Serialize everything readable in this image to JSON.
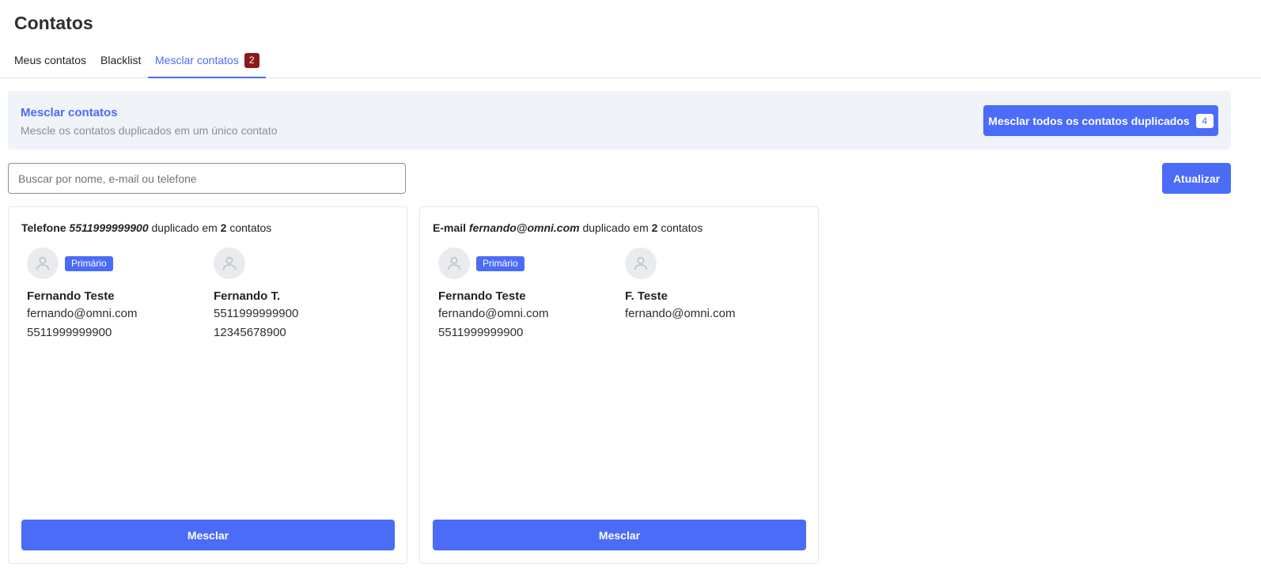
{
  "page": {
    "title": "Contatos"
  },
  "tabs": [
    {
      "label": "Meus contatos",
      "active": false
    },
    {
      "label": "Blacklist",
      "active": false
    },
    {
      "label": "Mesclar contatos",
      "active": true,
      "badge": "2"
    }
  ],
  "banner": {
    "title": "Mesclar contatos",
    "subtitle": "Mescle os contatos duplicados em um único contato",
    "merge_all_label": "Mesclar todos os contatos duplicados",
    "merge_all_count": "4"
  },
  "search": {
    "placeholder": "Buscar por nome, e-mail ou telefone",
    "value": ""
  },
  "refresh_label": "Atualizar",
  "groups": [
    {
      "field_label": "Telefone",
      "value": "5511999999900",
      "middle": "duplicado em",
      "count": "2",
      "suffix": "contatos",
      "contacts": [
        {
          "primary": true,
          "primary_label": "Primário",
          "avatar_icon": "user-icon",
          "name": "Fernando Teste",
          "lines": [
            "fernando@omni.com",
            "5511999999900"
          ]
        },
        {
          "primary": false,
          "avatar_icon": "user-icon",
          "name": "Fernando T.",
          "lines": [
            "5511999999900",
            "12345678900"
          ]
        }
      ],
      "merge_label": "Mesclar"
    },
    {
      "field_label": "E-mail",
      "value": "fernando@omni.com",
      "middle": "duplicado em",
      "count": "2",
      "suffix": "contatos",
      "contacts": [
        {
          "primary": true,
          "primary_label": "Primário",
          "avatar_icon": "user-icon",
          "name": "Fernando Teste",
          "lines": [
            "fernando@omni.com",
            "5511999999900"
          ]
        },
        {
          "primary": false,
          "avatar_icon": "user-icon",
          "name": "F. Teste",
          "lines": [
            "fernando@omni.com"
          ]
        }
      ],
      "merge_label": "Mesclar"
    }
  ],
  "colors": {
    "accent": "#4a6cf7",
    "tab_badge": "#8b1a1a",
    "banner_bg": "#f0f3f8"
  }
}
